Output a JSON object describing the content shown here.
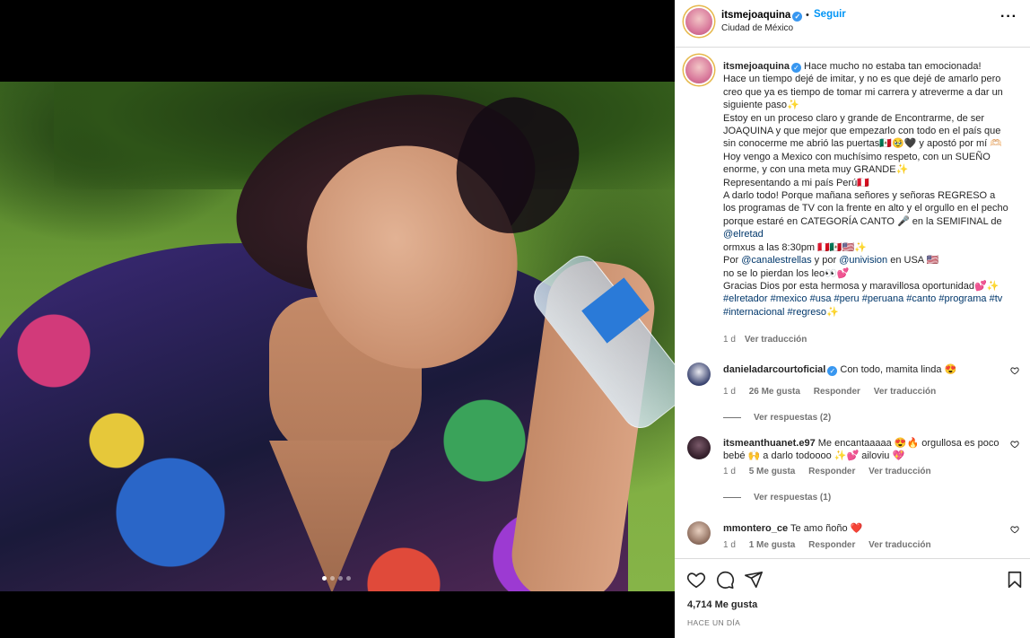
{
  "post": {
    "username": "itsmejoaquina",
    "follow_label": "Seguir",
    "separator": "•",
    "location": "Ciudad de México",
    "more_label": "···",
    "carousel_dots": 4,
    "carousel_active": 0
  },
  "caption": {
    "username": "itsmejoaquina",
    "lines": [
      "Hace mucho no estaba tan emocionada!",
      "Hace un tiempo dejé de imitar, y no es que dejé de amarlo pero creo que ya es tiempo de tomar mi carrera y atreverme a dar un siguiente paso✨",
      "Estoy en un proceso claro y grande de Encontrarme, de ser JOAQUINA y que mejor que empezarlo con todo en el país que sin conocerme me abrió las puertas🇲🇽🥹🖤 y apostó por mí 🫶🏻",
      "Hoy vengo a Mexico con muchísimo respeto, con un SUEÑO enorme, y con una meta muy GRANDE✨",
      "Representando a mi país Perú🇵🇪",
      "A darlo todo! Porque mañana señores y señoras REGRESO a los programas de TV con la frente en alto y el orgullo en el pecho porque estaré en CATEGORÍA CANTO 🎤 en la SEMIFINAL de ",
      "@elretad",
      "ormxus a las 8:30pm 🇵🇪🇲🇽🇺🇸✨",
      "Por ",
      "@canalestrellas",
      " y por ",
      "@univision",
      " en USA 🇺🇸",
      "no se lo pierdan los leo👀💕",
      "Gracias Dios por esta hermosa y maravillosa oportunidad💕✨",
      "#elretador #mexico #usa #peru #peruana #canto #programa #tv #internacional #regreso",
      "✨"
    ],
    "time": "1 d",
    "translate": "Ver traducción"
  },
  "comments": [
    {
      "username": "danieladarcourtoficial",
      "verified": true,
      "text": "Con todo, mamita linda 😍",
      "time": "1 d",
      "likes": "26 Me gusta",
      "reply": "Responder",
      "translate": "Ver traducción",
      "replies": "Ver respuestas (2)"
    },
    {
      "username": "itsmeanthuanet.e97",
      "verified": false,
      "text": "Me encantaaaaa 😍🔥 orgullosa es poco bebé 🙌 a darlo todoooo ✨💕 ailoviu 💖",
      "time": "1 d",
      "likes": "5 Me gusta",
      "reply": "Responder",
      "translate": "Ver traducción",
      "replies": "Ver respuestas (1)"
    },
    {
      "username": "mmontero_ce",
      "verified": false,
      "text": "Te amo ñoño ❤️",
      "time": "1 d",
      "likes": "1 Me gusta",
      "reply": "Responder",
      "translate": "Ver traducción"
    }
  ],
  "footer": {
    "likes": "4,714 Me gusta",
    "when": "HACE UN DÍA"
  },
  "colors": {
    "link": "#00376b",
    "follow": "#0095f6",
    "verified": "#3897f0",
    "muted": "#737373",
    "divider": "#dbdbdb"
  },
  "icons": [
    "heart-icon",
    "comment-icon",
    "share-icon",
    "bookmark-icon",
    "verified-icon",
    "more-icon"
  ]
}
